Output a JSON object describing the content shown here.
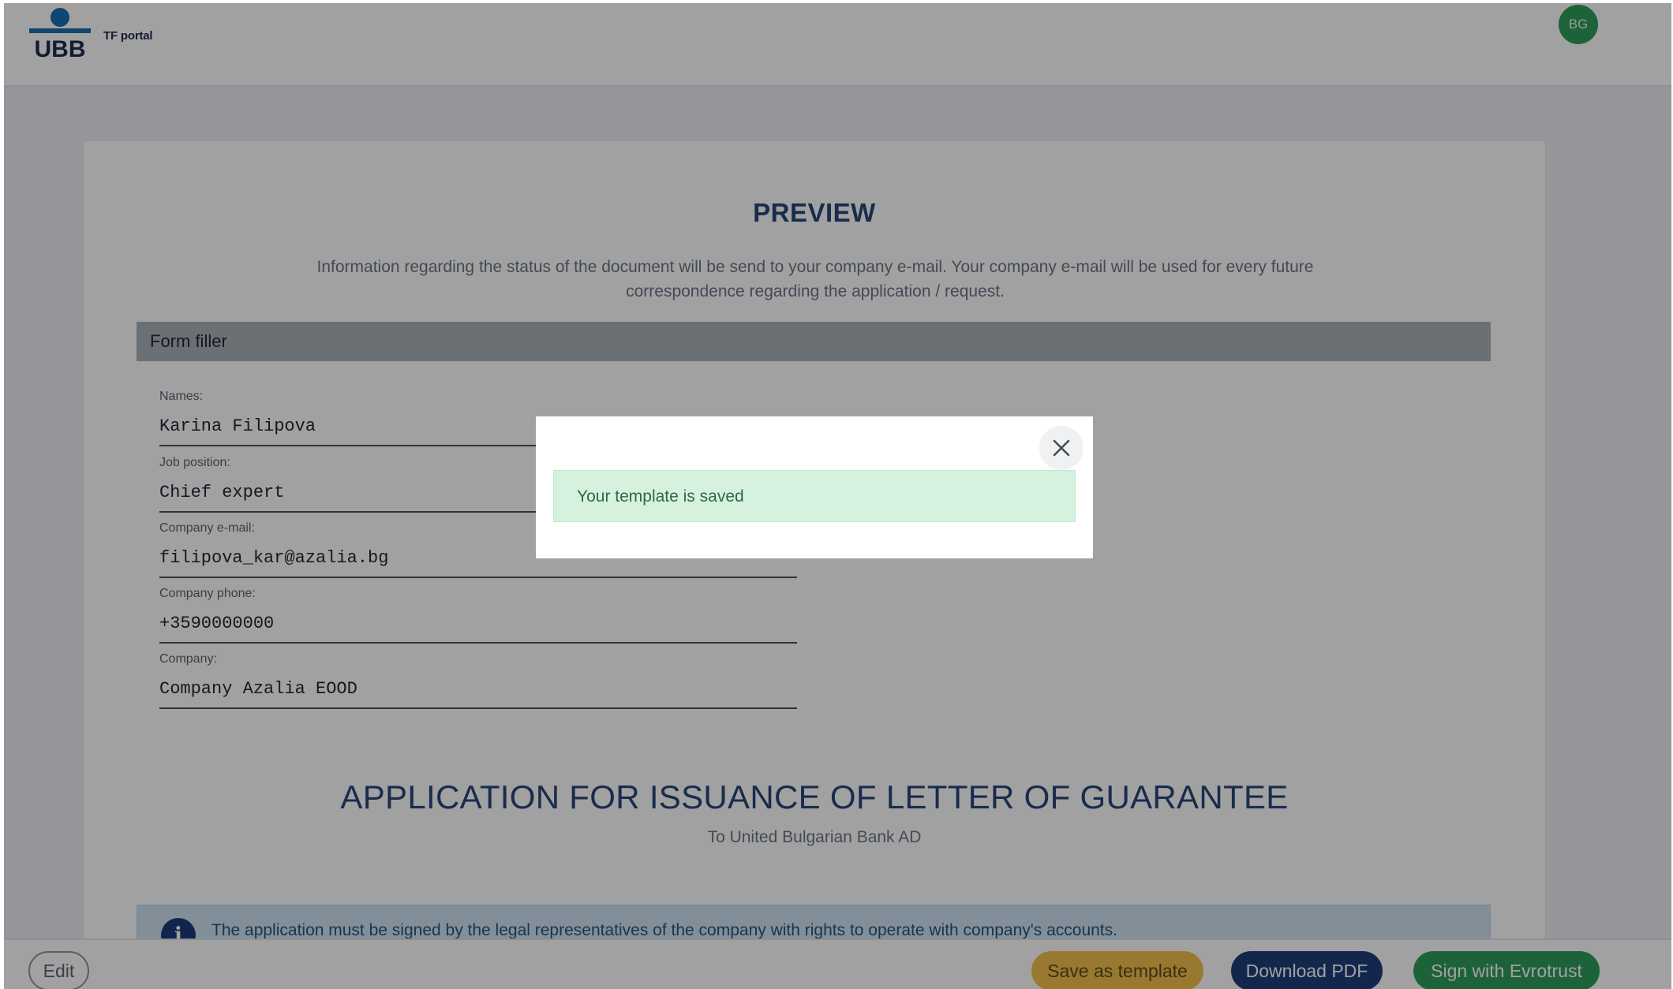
{
  "header": {
    "logo_text": "UBB",
    "portal_name": "TF portal",
    "avatar_initials": "BG"
  },
  "preview": {
    "title": "PREVIEW",
    "info": "Information regarding the status of the document will be send to your company e-mail. Your company e-mail will be used for every future correspondence regarding the application / request."
  },
  "form_filler": {
    "section_title": "Form filler",
    "fields": [
      {
        "label": "Names:",
        "value": "Karina Filipova"
      },
      {
        "label": "Job position:",
        "value": "Chief expert"
      },
      {
        "label": "Company e-mail:",
        "value": "filipova_kar@azalia.bg"
      },
      {
        "label": "Company phone:",
        "value": "+3590000000"
      },
      {
        "label": "Company:",
        "value": "Company Azalia EOOD"
      }
    ]
  },
  "application": {
    "title": "APPLICATION FOR ISSUANCE OF LETTER OF GUARANTEE",
    "subtitle": "To United Bulgarian Bank AD",
    "alert_icon": "info-icon",
    "alert_text": "The application must be signed by the legal representatives of the company with rights to operate with company's accounts."
  },
  "footer": {
    "edit_label": "Edit",
    "save_template_label": "Save as template",
    "download_pdf_label": "Download PDF",
    "sign_label": "Sign with Evrotrust"
  },
  "modal": {
    "close_icon": "close-icon",
    "message": "Your template is saved"
  },
  "colors": {
    "brand_blue": "#29477a",
    "brand_green": "#2e9e5b",
    "template_yellow": "#f3c04b",
    "success_bg": "#d6f1de"
  }
}
